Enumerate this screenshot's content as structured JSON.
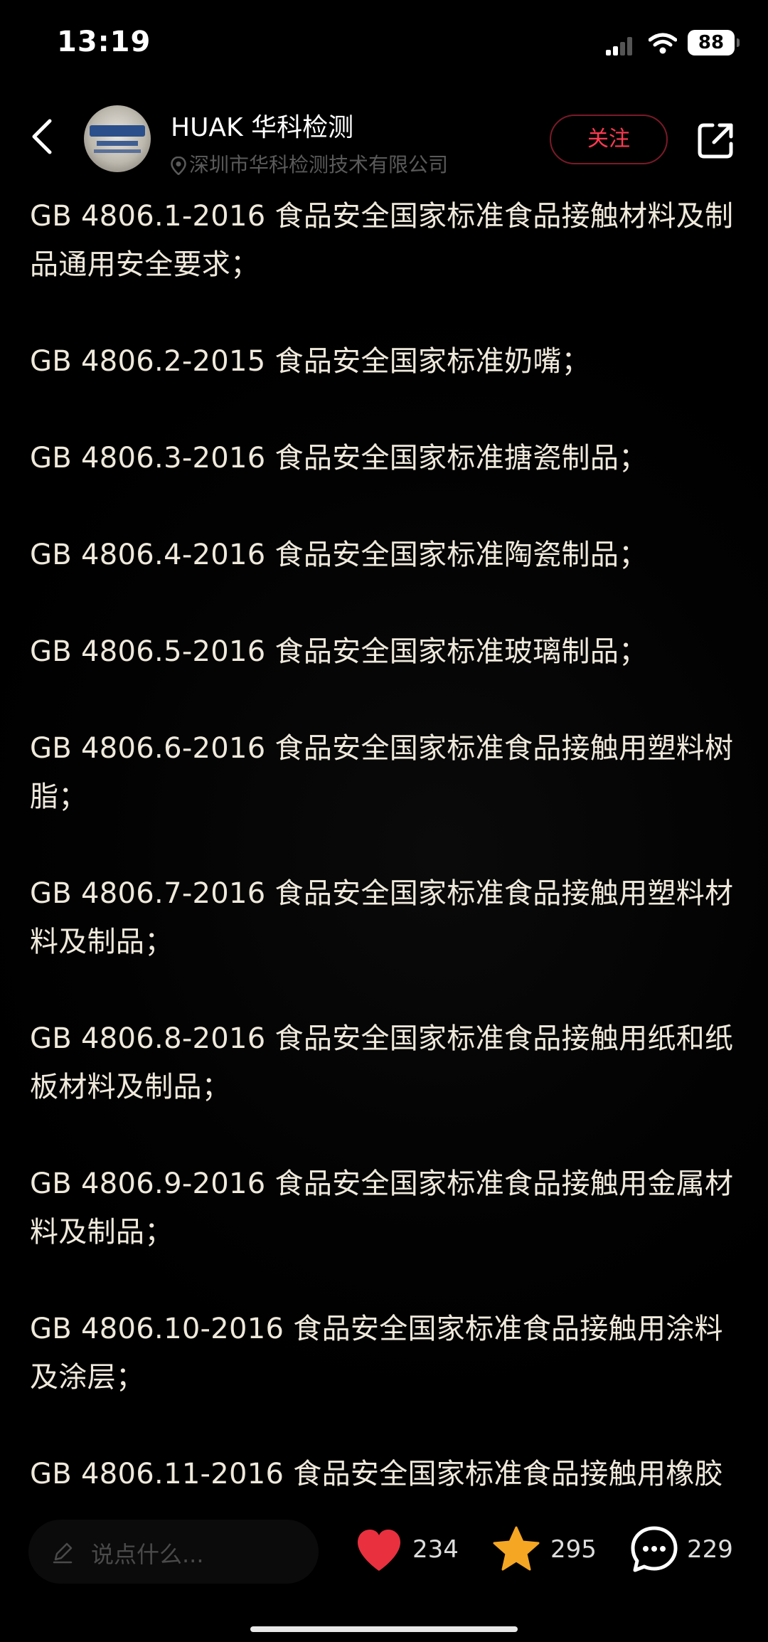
{
  "status_bar": {
    "time": "13:19",
    "battery": "88",
    "icons": [
      "signal-icon",
      "wifi-icon",
      "battery-icon"
    ]
  },
  "header": {
    "author_name": "HUAK 华科检测",
    "author_location": "深圳市华科检测技术有限公司",
    "follow_label": "关注",
    "icons": [
      "back-arrow-icon",
      "location-pin-icon",
      "share-icon"
    ]
  },
  "article": {
    "paragraphs": [
      "GB 4806.1-2016 食品安全国家标准食品接触材料及制品通用安全要求；",
      "GB 4806.2-2015 食品安全国家标准奶嘴；",
      "GB 4806.3-2016 食品安全国家标准搪瓷制品；",
      "GB 4806.4-2016 食品安全国家标准陶瓷制品；",
      "GB 4806.5-2016 食品安全国家标准玻璃制品；",
      "GB 4806.6-2016 食品安全国家标准食品接触用塑料树脂；",
      "GB 4806.7-2016 食品安全国家标准食品接触用塑料材料及制品；",
      "GB 4806.8-2016 食品安全国家标准食品接触用纸和纸板材料及制品；",
      "GB 4806.9-2016 食品安全国家标准食品接触用金属材料及制品；",
      "GB 4806.10-2016 食品安全国家标准食品接触用涂料及涂层；",
      "GB 4806.11-2016 食品安全国家标准食品接触用橡胶"
    ]
  },
  "bottom_bar": {
    "comment_placeholder": "说点什么...",
    "likes": "234",
    "favorites": "295",
    "comments": "229",
    "colors": {
      "like": "#e8303f",
      "favorite": "#f5a623",
      "follow": "#ff3a52"
    },
    "icons": [
      "pencil-icon",
      "heart-icon",
      "star-icon",
      "comment-bubble-icon"
    ]
  }
}
